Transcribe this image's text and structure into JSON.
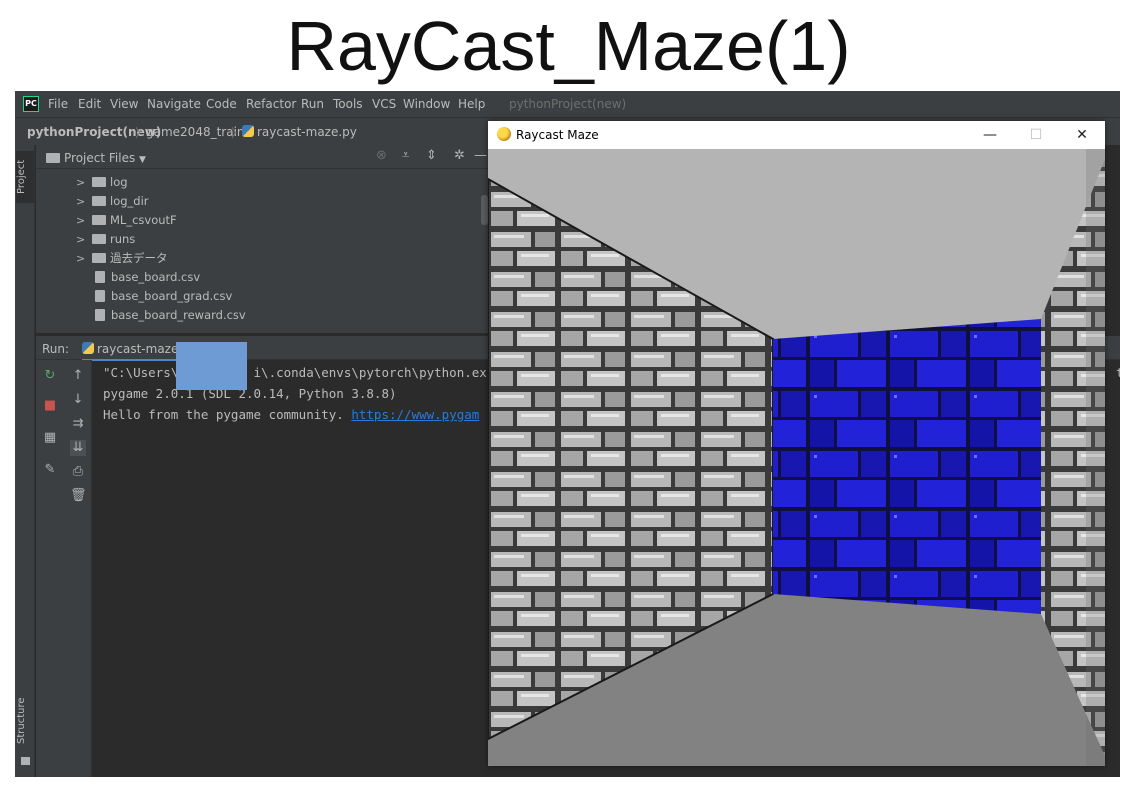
{
  "slide": {
    "title": "RayCast_Maze(1)"
  },
  "ide": {
    "logo": "PC",
    "menu": [
      {
        "mnemonic": "F",
        "rest": "ile"
      },
      {
        "mnemonic": "E",
        "rest": "dit"
      },
      {
        "mnemonic": "V",
        "rest": "iew"
      },
      {
        "mnemonic": "N",
        "rest": "avigate"
      },
      {
        "mnemonic": "C",
        "rest": "ode"
      },
      {
        "mnemonic": "R",
        "rest": "efactor"
      },
      {
        "mnemonic": "R",
        "rest": "un",
        "pre": "R",
        "post": "n",
        "mid": "u"
      },
      {
        "mnemonic": "T",
        "rest": "ools"
      },
      {
        "mnemonic": "S",
        "rest": "",
        "pre": "VC"
      },
      {
        "mnemonic": "W",
        "rest": "indow"
      },
      {
        "mnemonic": "H",
        "rest": "elp"
      }
    ],
    "menu_labels": [
      "File",
      "Edit",
      "View",
      "Navigate",
      "Code",
      "Refactor",
      "Run",
      "Tools",
      "VCS",
      "Window",
      "Help"
    ],
    "project_name": "pythonProject(new)",
    "breadcrumb": {
      "project": "pythonProject(new)",
      "folder": "game2048_train",
      "file": "raycast-maze.py"
    },
    "side_tabs": {
      "project": "Project",
      "structure": "Structure"
    },
    "project_panel": {
      "title": "Project Files",
      "tree": [
        {
          "type": "folder",
          "name": "log"
        },
        {
          "type": "folder",
          "name": "log_dir"
        },
        {
          "type": "folder",
          "name": "ML_csvoutF"
        },
        {
          "type": "folder",
          "name": "runs"
        },
        {
          "type": "folder",
          "name": "過去データ"
        },
        {
          "type": "file",
          "name": "base_board.csv"
        },
        {
          "type": "file",
          "name": "base_board_grad.csv"
        },
        {
          "type": "file",
          "name": "base_board_reward.csv"
        }
      ]
    },
    "run_panel": {
      "label": "Run:",
      "config": "raycast-maze",
      "console": [
        "\"C:\\Users\\          i\\.conda\\envs\\pytorch\\python.ex",
        "pygame 2.0.1 (SDL 2.0.14, Python 3.8.8)",
        "Hello from the pygame community. "
      ],
      "console_link": "https://www.pygam",
      "overflow_text": "t-"
    }
  },
  "game_window": {
    "title": "Raycast Maze",
    "buttons": {
      "minimize": "—",
      "maximize": "☐",
      "close": "✕"
    },
    "colors": {
      "ceiling": "#b4b4b4",
      "floor": "#828282",
      "stone": "#a8a8a8",
      "blue_wall": "#1a1acc"
    }
  }
}
